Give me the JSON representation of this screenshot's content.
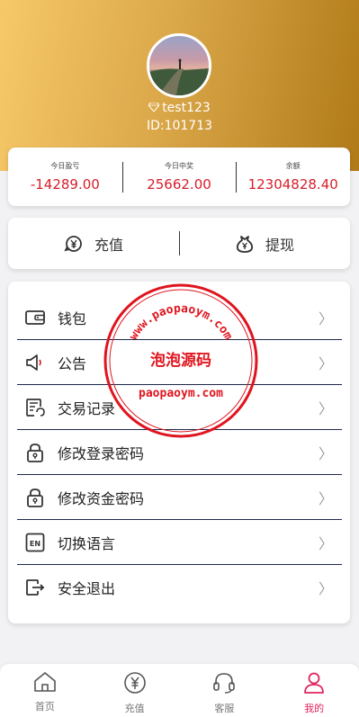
{
  "profile": {
    "username": "test123",
    "id_text": "ID:101713"
  },
  "stats": [
    {
      "label": "今日盈亏",
      "value": "-14289.00"
    },
    {
      "label": "今日中奖",
      "value": "25662.00"
    },
    {
      "label": "余额",
      "value": "12304828.40"
    }
  ],
  "actions": {
    "recharge": "充值",
    "withdraw": "提现"
  },
  "menu": [
    {
      "label": "钱包",
      "icon": "wallet-icon"
    },
    {
      "label": "公告",
      "icon": "megaphone-icon"
    },
    {
      "label": "交易记录",
      "icon": "transaction-record-icon"
    },
    {
      "label": "修改登录密码",
      "icon": "lock-icon"
    },
    {
      "label": "修改资金密码",
      "icon": "lock-icon"
    },
    {
      "label": "切换语言",
      "icon": "language-en-icon"
    },
    {
      "label": "安全退出",
      "icon": "logout-icon"
    }
  ],
  "watermark": {
    "top_text": "www.paopaoym.com",
    "center_text": "泡泡源码",
    "bottom_text": "paopaoym.com"
  },
  "tabs": [
    {
      "label": "首页",
      "icon": "home-icon"
    },
    {
      "label": "充值",
      "icon": "yen-icon"
    },
    {
      "label": "客服",
      "icon": "headset-icon"
    },
    {
      "label": "我的",
      "icon": "user-icon",
      "active": true
    }
  ],
  "colors": {
    "header_gradient_start": "#f7c968",
    "header_gradient_end": "#b07a18",
    "stat_value": "#d71d2a",
    "active_tab": "#e0245e",
    "watermark": "#e0141e"
  }
}
